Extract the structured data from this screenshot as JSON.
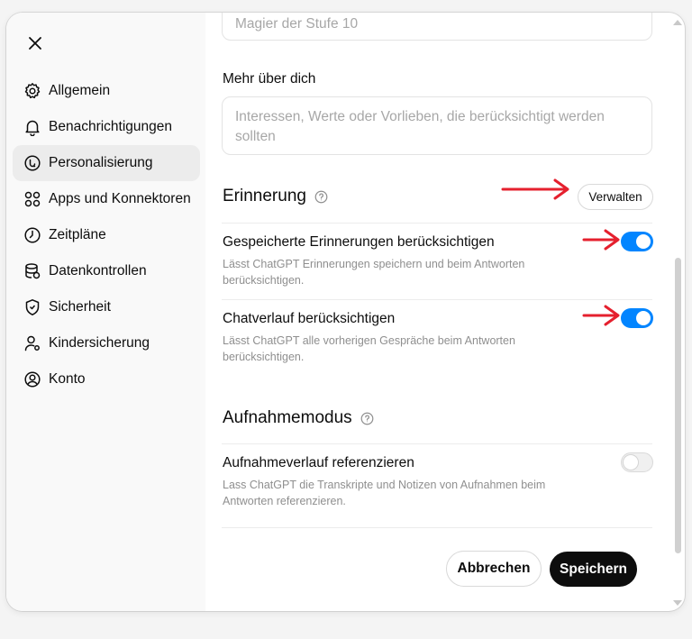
{
  "sidebar": {
    "items": [
      {
        "label": "Allgemein",
        "icon": "gear-icon"
      },
      {
        "label": "Benachrichtigungen",
        "icon": "bell-icon"
      },
      {
        "label": "Personalisierung",
        "icon": "personalization-icon",
        "active": true
      },
      {
        "label": "Apps und Konnektoren",
        "icon": "apps-grid-icon"
      },
      {
        "label": "Zeitpläne",
        "icon": "clock-icon"
      },
      {
        "label": "Datenkontrollen",
        "icon": "database-icon"
      },
      {
        "label": "Sicherheit",
        "icon": "shield-icon"
      },
      {
        "label": "Kindersicherung",
        "icon": "parental-user-icon"
      },
      {
        "label": "Konto",
        "icon": "account-icon"
      }
    ]
  },
  "profile": {
    "occupation_placeholder": "Magier der Stufe 10",
    "more_about_label": "Mehr über dich",
    "more_about_placeholder": "Interessen, Werte oder Vorlieben, die berücksichtigt werden sollten"
  },
  "memory": {
    "title": "Erinnerung",
    "manage_button": "Verwalten",
    "saved_memories": {
      "title": "Gespeicherte Erinnerungen berücksichtigen",
      "description": "Lässt ChatGPT Erinnerungen speichern und beim Antworten berücksichtigen.",
      "enabled": true
    },
    "chat_history": {
      "title": "Chatverlauf berücksichtigen",
      "description": "Lässt ChatGPT alle vorherigen Gespräche beim Antworten berücksichtigen.",
      "enabled": true
    }
  },
  "recording": {
    "title": "Aufnahmemodus",
    "history": {
      "title": "Aufnahmeverlauf referenzieren",
      "description": "Lass ChatGPT die Transkripte und Notizen von Aufnahmen beim Antworten referenzieren.",
      "enabled": false
    }
  },
  "footer": {
    "cancel": "Abbrechen",
    "save": "Speichern"
  },
  "colors": {
    "toggle_on": "#0285ff",
    "annotation_arrow": "#e5202e",
    "primary_button": "#0d0d0d"
  }
}
